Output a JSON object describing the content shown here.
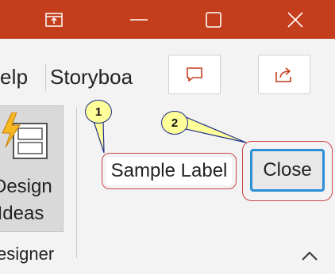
{
  "titlebar": {
    "background": "#c43e1c",
    "icons": [
      "ribbon-display-icon",
      "minimize-icon",
      "maximize-icon",
      "close-window-icon"
    ]
  },
  "ribbon": {
    "tabs": [
      {
        "label": "elp"
      },
      {
        "label": "Storyboa"
      }
    ],
    "comments_icon": "comment-icon",
    "share_icon": "share-icon",
    "design_ideas": {
      "line1": "Design",
      "line2": "Ideas",
      "icon": "lightning-layout-icon"
    },
    "group_label": "esigner",
    "collapse_icon": "chevron-up-icon"
  },
  "annotations": {
    "callout1": "1",
    "callout2": "2",
    "sample_label": "Sample Label",
    "close_label": "Close",
    "highlight_color": "#cc4444",
    "callout_fill": "#ffff99",
    "focus_border": "#2b8fd6"
  }
}
